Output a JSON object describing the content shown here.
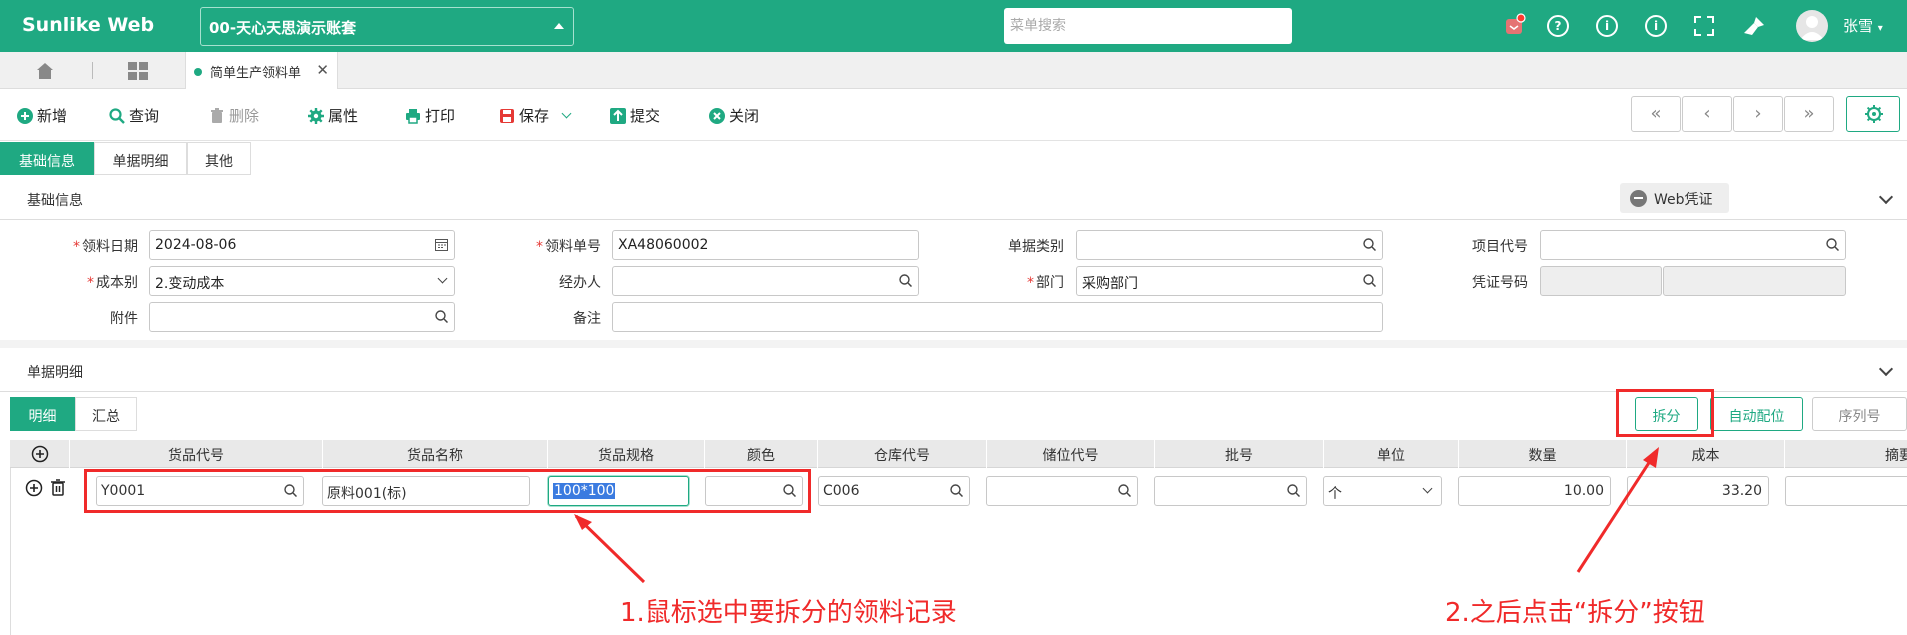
{
  "topbar": {
    "brand": "Sunlike Web",
    "account": "00-天心天思演示账套",
    "search_placeholder": "菜单搜索",
    "user": "张雪"
  },
  "tabstrip": {
    "doc_tab": "简单生产领料单"
  },
  "toolbar": {
    "new": "新增",
    "query": "查询",
    "delete": "删除",
    "props": "属性",
    "print": "打印",
    "save": "保存",
    "submit": "提交",
    "close": "关闭"
  },
  "section_tabs": [
    "基础信息",
    "单据明细",
    "其他"
  ],
  "basic": {
    "title": "基础信息",
    "web_voucher": "Web凭证",
    "date_label": "领料日期",
    "date_value": "2024-08-06",
    "no_label": "领料单号",
    "no_value": "XA48060002",
    "doctype_label": "单据类别",
    "project_label": "项目代号",
    "cost_label": "成本别",
    "cost_value": "2.变动成本",
    "handler_label": "经办人",
    "dept_label": "部门",
    "dept_value": "采购部门",
    "voucher_label": "凭证号码",
    "attach_label": "附件",
    "remark_label": "备注"
  },
  "detail": {
    "title": "单据明细",
    "tabs": [
      "明细",
      "汇总"
    ],
    "split": "拆分",
    "auto": "自动配位",
    "serial": "序列号",
    "headers": [
      "货品代号",
      "货品名称",
      "货品规格",
      "颜色",
      "仓库代号",
      "储位代号",
      "批号",
      "单位",
      "数量",
      "成本",
      "摘要"
    ],
    "row": {
      "code": "Y0001",
      "name": "原料001(标)",
      "spec": "100*100",
      "color": "",
      "wh": "C006",
      "loc": "",
      "batch": "",
      "unit": "个",
      "qty": "10.00",
      "cost": "33.20"
    }
  },
  "annotations": {
    "step1": "1.鼠标选中要拆分的领料记录",
    "step2": "2.之后点击“拆分”按钮"
  },
  "colors": {
    "accent": "#1fa982",
    "annotation": "#f02a2a"
  }
}
